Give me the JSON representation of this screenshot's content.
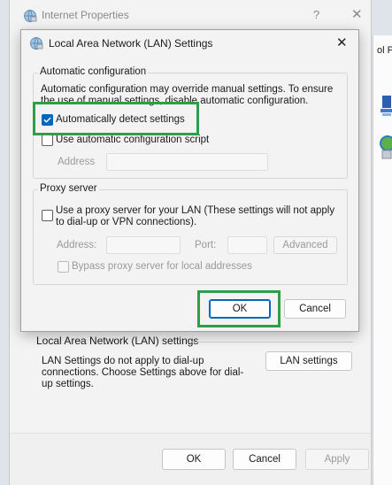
{
  "background_window": {
    "title": "Internet Properties",
    "help_glyph": "?",
    "close_glyph": "✕",
    "lan_section": {
      "header": "Local Area Network (LAN) settings",
      "description": "LAN Settings do not apply to dial-up connections. Choose Settings above for dial-up settings.",
      "button_label": "LAN settings"
    },
    "footer": {
      "ok_label": "OK",
      "cancel_label": "Cancel",
      "apply_label": "Apply"
    }
  },
  "right_strip": {
    "text": "ol P"
  },
  "dialog": {
    "title": "Local Area Network (LAN) Settings",
    "close_glyph": "✕",
    "automatic_configuration": {
      "group_label": "Automatic configuration",
      "description": "Automatic configuration may override manual settings.  To ensure the use of manual settings, disable automatic configuration.",
      "auto_detect_label": "Automatically detect settings",
      "auto_detect_checked": true,
      "use_script_label": "Use automatic configuration script",
      "use_script_checked": false,
      "address_label": "Address",
      "address_value": ""
    },
    "proxy_server": {
      "group_label": "Proxy server",
      "use_proxy_label": "Use a proxy server for your LAN (These settings will not apply to dial-up or VPN connections).",
      "use_proxy_checked": false,
      "address_label": "Address:",
      "address_value": "",
      "port_label": "Port:",
      "port_value": "",
      "advanced_label": "Advanced",
      "bypass_label": "Bypass proxy server for local addresses",
      "bypass_checked": false
    },
    "ok_label": "OK",
    "cancel_label": "Cancel"
  },
  "colors": {
    "accent": "#0067c0",
    "highlight": "#2e9e4a",
    "disabled_text": "#9a9a9a"
  },
  "icons": [
    "globe-network-icon",
    "close-icon",
    "help-icon",
    "checkmark-icon",
    "network-icon"
  ]
}
